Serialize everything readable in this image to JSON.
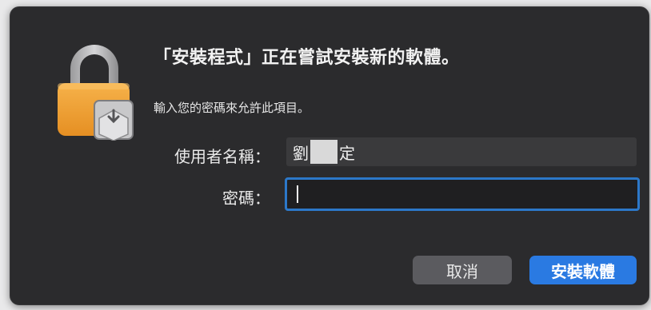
{
  "dialog": {
    "title": "「安裝程式」正在嘗試安裝新的軟體。",
    "message": "輸入您的密碼來允許此項目。",
    "icon": "lock-installer-icon"
  },
  "form": {
    "username_label": "使用者名稱：",
    "username_value_start": "劉",
    "username_value_end": "定",
    "password_label": "密碼：",
    "password_value": ""
  },
  "buttons": {
    "cancel_label": "取消",
    "install_label": "安裝軟體"
  },
  "colors": {
    "dialog_bg": "#2b2b2d",
    "accent": "#2a7ae2",
    "lock_body": "#f2a53a",
    "lock_shackle": "#b9b9bb"
  }
}
